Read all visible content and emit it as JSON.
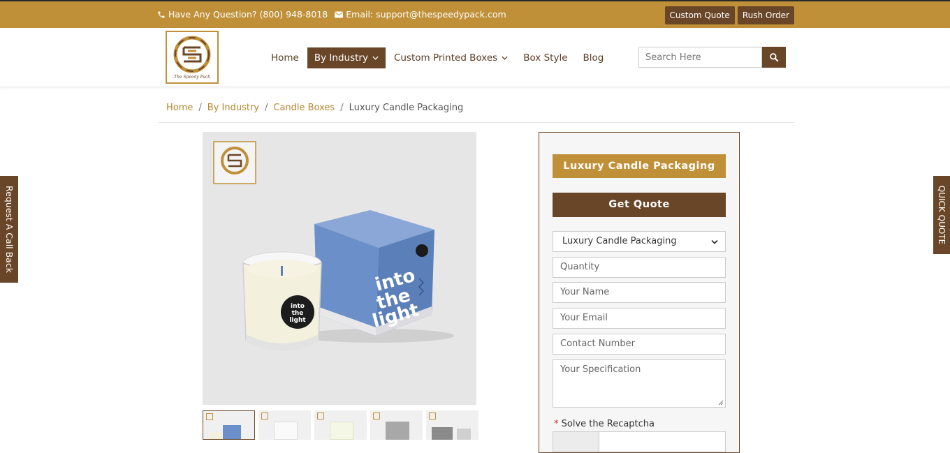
{
  "topbar": {
    "phone_text": "Have Any Question? (800) 948-8018",
    "email_text": "Email: support@thespeedypack.com",
    "custom_quote": "Custom Quote",
    "rush_order": "Rush Order"
  },
  "nav": {
    "items": [
      {
        "label": "Home"
      },
      {
        "label": "By Industry"
      },
      {
        "label": "Custom Printed Boxes"
      },
      {
        "label": "Box Style"
      },
      {
        "label": "Blog"
      }
    ]
  },
  "search": {
    "placeholder": "Search Here"
  },
  "breadcrumb": {
    "home": "Home",
    "industry": "By Industry",
    "category": "Candle Boxes",
    "current": "Luxury Candle Packaging",
    "separator": "/"
  },
  "product": {
    "box_text_1": "into",
    "box_text_2": "the",
    "box_text_3": "light"
  },
  "quote": {
    "title": "Luxury Candle Packaging",
    "get_quote": "Get Quote",
    "selected_product": "Luxury Candle Packaging",
    "quantity_placeholder": "Quantity",
    "name_placeholder": "Your Name",
    "email_placeholder": "Your Email",
    "contact_placeholder": "Contact Number",
    "spec_placeholder": "Your Specification",
    "recaptcha_label": "Solve the Recaptcha",
    "required_mark": "*"
  },
  "side": {
    "left_label": "Request A Call Back",
    "right_label": "QUICK QUOTE"
  },
  "colors": {
    "gold": "#c09038",
    "brown": "#6a4628",
    "box_blue": "#6b8fc8"
  }
}
